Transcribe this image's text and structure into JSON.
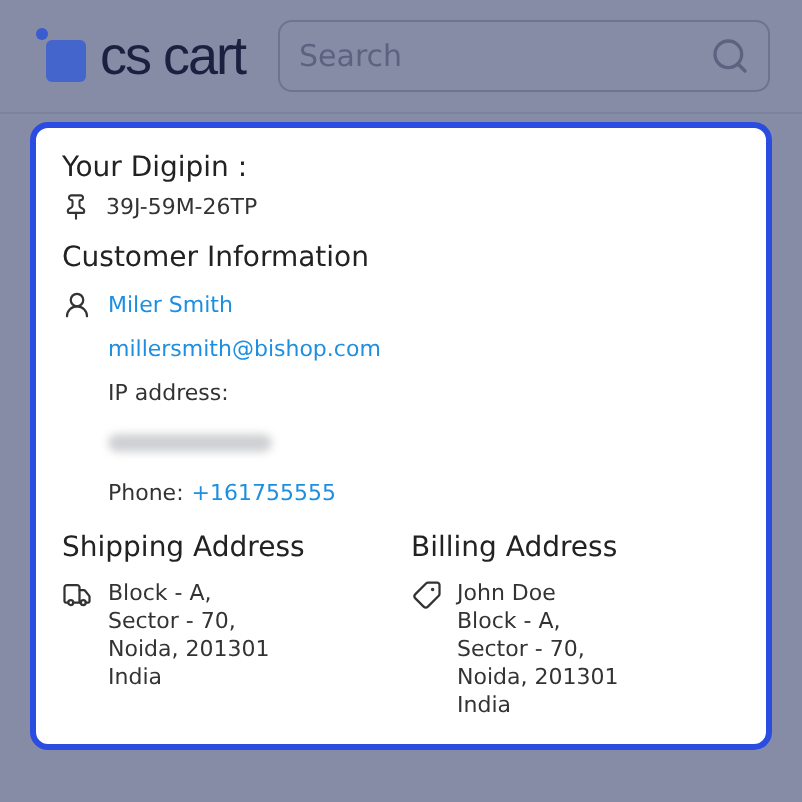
{
  "header": {
    "logo": "cs cart",
    "search": {
      "placeholder": "Search"
    }
  },
  "digipin": {
    "title": "Your Digipin :",
    "code": "39J-59M-26TP"
  },
  "customer": {
    "title": "Customer Information",
    "name": "Miler Smith",
    "email": "millersmith@bishop.com",
    "ip_label": "IP address:",
    "ip_redacted": true,
    "phone_label": "Phone:",
    "phone": "+161755555"
  },
  "addresses": [
    {
      "kind": "shipping",
      "title": "Shipping Address",
      "lines": [
        "Block - A,",
        "Sector - 70,",
        "Noida, 201301",
        "India"
      ]
    },
    {
      "kind": "billing",
      "title": "Billing Address",
      "lines": [
        "John Doe",
        "Block - A,",
        "Sector - 70,",
        "Noida, 201301",
        "India"
      ]
    }
  ]
}
